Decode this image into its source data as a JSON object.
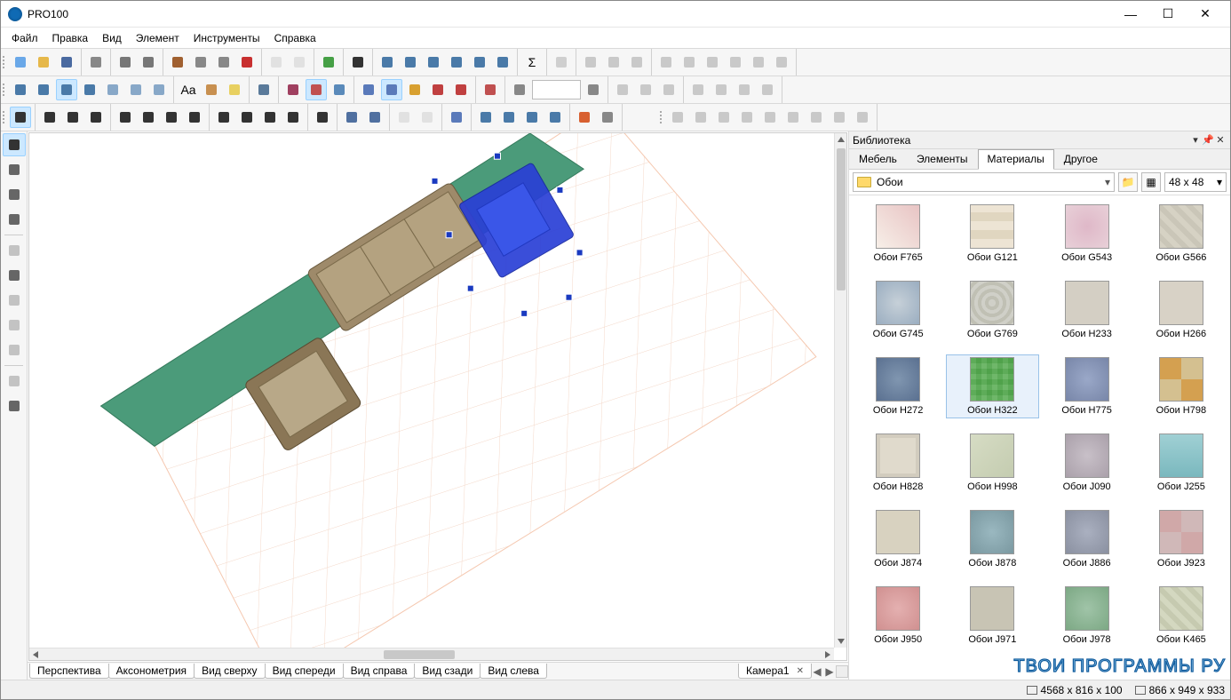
{
  "titlebar": {
    "title": "PRO100"
  },
  "menu": [
    "Файл",
    "Правка",
    "Вид",
    "Элемент",
    "Инструменты",
    "Справка"
  ],
  "viewtabs": [
    "Перспектива",
    "Аксонометрия",
    "Вид сверху",
    "Вид спереди",
    "Вид справа",
    "Вид сзади",
    "Вид слева"
  ],
  "camera_tab": "Камера1",
  "library": {
    "title": "Библиотека",
    "tabs": [
      "Мебель",
      "Элементы",
      "Материалы",
      "Другое"
    ],
    "active_tab": 2,
    "path": "Обои",
    "thumb_size": "48 x  48",
    "selected": "Обои H322",
    "items": [
      {
        "id": "F765",
        "label": "Обои F765"
      },
      {
        "id": "G121",
        "label": "Обои G121"
      },
      {
        "id": "G543",
        "label": "Обои G543"
      },
      {
        "id": "G566",
        "label": "Обои G566"
      },
      {
        "id": "G745",
        "label": "Обои G745"
      },
      {
        "id": "G769",
        "label": "Обои G769"
      },
      {
        "id": "H233",
        "label": "Обои H233"
      },
      {
        "id": "H266",
        "label": "Обои H266"
      },
      {
        "id": "H272",
        "label": "Обои H272"
      },
      {
        "id": "H322",
        "label": "Обои H322"
      },
      {
        "id": "H775",
        "label": "Обои H775"
      },
      {
        "id": "H798",
        "label": "Обои H798"
      },
      {
        "id": "H828",
        "label": "Обои H828"
      },
      {
        "id": "H998",
        "label": "Обои H998"
      },
      {
        "id": "J090",
        "label": "Обои J090"
      },
      {
        "id": "J255",
        "label": "Обои J255"
      },
      {
        "id": "J874",
        "label": "Обои J874"
      },
      {
        "id": "J878",
        "label": "Обои J878"
      },
      {
        "id": "J886",
        "label": "Обои J886"
      },
      {
        "id": "J923",
        "label": "Обои J923"
      },
      {
        "id": "J950",
        "label": "Обои J950"
      },
      {
        "id": "J971",
        "label": "Обои J971"
      },
      {
        "id": "J978",
        "label": "Обои J978"
      },
      {
        "id": "K465",
        "label": "Обои K465"
      }
    ]
  },
  "status": {
    "dims1": "4568 x 816 x 100",
    "dims2": "866 x 949 x 933"
  },
  "watermark": "ТВОИ ПРОГРАММЫ РУ",
  "toolbars": {
    "row1": [
      {
        "g": [
          {
            "n": "new-icon",
            "c": "#6aa8e8"
          },
          {
            "n": "open-icon",
            "c": "#e6b84a"
          },
          {
            "n": "save-icon",
            "c": "#4a6aa0"
          }
        ]
      },
      {
        "g": [
          {
            "n": "export-icon",
            "c": "#888"
          }
        ]
      },
      {
        "g": [
          {
            "n": "print-icon",
            "c": "#777"
          },
          {
            "n": "print-preview-icon",
            "c": "#777"
          }
        ]
      },
      {
        "g": [
          {
            "n": "cut-icon",
            "c": "#a06030"
          },
          {
            "n": "copy-icon",
            "c": "#888"
          },
          {
            "n": "paste-icon",
            "c": "#888"
          },
          {
            "n": "delete-icon",
            "c": "#c83030"
          }
        ]
      },
      {
        "g": [
          {
            "n": "undo-icon",
            "c": "#bbb",
            "d": true
          },
          {
            "n": "redo-icon",
            "c": "#bbb",
            "d": true
          }
        ]
      },
      {
        "g": [
          {
            "n": "properties-icon",
            "c": "#46a046"
          }
        ]
      },
      {
        "g": [
          {
            "n": "check-icon",
            "c": "#333"
          }
        ]
      },
      {
        "g": [
          {
            "n": "align-panel-icon",
            "c": "#4a7aa8"
          },
          {
            "n": "distribute-icon",
            "c": "#4a7aa8"
          },
          {
            "n": "arrange-icon",
            "c": "#4a7aa8"
          },
          {
            "n": "flatten-icon",
            "c": "#4a7aa8"
          },
          {
            "n": "group-panel-icon",
            "c": "#4a7aa8"
          },
          {
            "n": "layers-icon",
            "c": "#4a7aa8"
          }
        ]
      },
      {
        "g": [
          {
            "n": "sum-icon",
            "t": "Σ"
          }
        ]
      },
      {
        "g": [
          {
            "n": "mail-icon",
            "c": "#888",
            "d": true
          }
        ]
      },
      {
        "g": [
          {
            "n": "flip-h-icon",
            "d": true
          },
          {
            "n": "flip-v-icon",
            "d": true
          },
          {
            "n": "mirror-icon",
            "d": true
          }
        ]
      },
      {
        "g": [
          {
            "n": "align-left-icon",
            "d": true
          },
          {
            "n": "align-center-h-icon",
            "d": true
          },
          {
            "n": "align-right-icon",
            "d": true
          },
          {
            "n": "align-top-icon",
            "d": true
          },
          {
            "n": "align-center-v-icon",
            "d": true
          },
          {
            "n": "align-bottom-icon",
            "d": true
          }
        ]
      }
    ],
    "row2": [
      {
        "g": [
          {
            "n": "view-persp-icon",
            "c": "#4a7aa8"
          },
          {
            "n": "view-axo-icon",
            "c": "#4a7aa8"
          },
          {
            "n": "view-top-icon",
            "c": "#4a7aa8",
            "a": true
          },
          {
            "n": "view-front-icon",
            "c": "#4a7aa8"
          },
          {
            "n": "view-right-icon",
            "c": "#88a8c8"
          },
          {
            "n": "view-back-icon",
            "c": "#88a8c8"
          },
          {
            "n": "view-left-icon",
            "c": "#88a8c8"
          }
        ]
      },
      {
        "g": [
          {
            "n": "text-annot-icon",
            "t": "Aa"
          },
          {
            "n": "material-ball-icon",
            "c": "#c89050"
          },
          {
            "n": "light-icon",
            "c": "#e8d060"
          }
        ]
      },
      {
        "g": [
          {
            "n": "link-icon",
            "c": "#5a7a9a"
          }
        ]
      },
      {
        "g": [
          {
            "n": "dimension-icon",
            "c": "#a04060"
          },
          {
            "n": "grid-icon",
            "c": "#c05050",
            "a": true
          },
          {
            "n": "visibility-icon",
            "c": "#5a8aba"
          }
        ]
      },
      {
        "g": [
          {
            "n": "snap-end-icon",
            "c": "#5a7aba"
          },
          {
            "n": "snap-mid-icon",
            "c": "#5a7aba",
            "a": true
          },
          {
            "n": "snap-center-icon",
            "c": "#d8a030"
          },
          {
            "n": "magnet-icon",
            "c": "#c04040"
          },
          {
            "n": "target-icon",
            "c": "#c04040"
          }
        ]
      },
      {
        "g": [
          {
            "n": "camera-icon",
            "c": "#c05050"
          }
        ]
      },
      {
        "g": [
          {
            "n": "zoom-out-icon",
            "c": "#888"
          },
          {
            "n": "zoom-combo",
            "combo": true
          },
          {
            "n": "zoom-in-icon",
            "c": "#888"
          }
        ]
      },
      {
        "g": [
          {
            "n": "guide-h-icon",
            "d": true
          },
          {
            "n": "guide-v-icon",
            "d": true
          },
          {
            "n": "guide-both-icon",
            "d": true
          }
        ]
      },
      {
        "g": [
          {
            "n": "dim-linear-icon",
            "d": true
          },
          {
            "n": "dim-aligned-icon",
            "d": true
          },
          {
            "n": "dim-vert-icon",
            "d": true
          },
          {
            "n": "dim-gap-icon",
            "d": true
          }
        ]
      }
    ],
    "row3": [
      {
        "g": [
          {
            "n": "snap-grid-icon",
            "c": "#333",
            "a": true
          }
        ]
      },
      {
        "g": [
          {
            "n": "select-icon",
            "c": "#333"
          },
          {
            "n": "node-edit-icon",
            "c": "#333"
          },
          {
            "n": "polyline-icon",
            "c": "#333"
          }
        ]
      },
      {
        "g": [
          {
            "n": "group-icon",
            "c": "#333"
          },
          {
            "n": "ungroup-icon",
            "c": "#333"
          },
          {
            "n": "anchor-icon",
            "c": "#333"
          },
          {
            "n": "unanchor-icon",
            "c": "#333"
          }
        ]
      },
      {
        "g": [
          {
            "n": "rotate-icon",
            "c": "#333"
          },
          {
            "n": "move-icon",
            "c": "#333"
          },
          {
            "n": "mirror2-icon",
            "c": "#333"
          },
          {
            "n": "scale-icon",
            "c": "#333"
          }
        ]
      },
      {
        "g": [
          {
            "n": "ruler-icon",
            "c": "#333"
          }
        ]
      },
      {
        "g": [
          {
            "n": "hide-icon",
            "c": "#5070a0"
          },
          {
            "n": "unhide-icon",
            "c": "#5070a0"
          }
        ]
      },
      {
        "g": [
          {
            "n": "lock-icon",
            "c": "#bbb",
            "d": true
          },
          {
            "n": "unlock-icon",
            "c": "#bbb",
            "d": true
          }
        ]
      },
      {
        "g": [
          {
            "n": "crosshair-icon",
            "c": "#5a7aba"
          }
        ]
      },
      {
        "g": [
          {
            "n": "snap-perp-icon",
            "c": "#4a7aa8"
          },
          {
            "n": "snap-tan-icon",
            "c": "#4a7aa8"
          },
          {
            "n": "snap-near-icon",
            "c": "#4a7aa8"
          },
          {
            "n": "snap-int-icon",
            "c": "#4a7aa8"
          }
        ]
      },
      {
        "g": [
          {
            "n": "explode-icon",
            "c": "#d86030"
          },
          {
            "n": "combine-icon",
            "c": "#888"
          }
        ]
      },
      {
        "spacer": true
      },
      {
        "g": [
          {
            "n": "panel-a-icon",
            "d": true
          },
          {
            "n": "panel-b-icon",
            "d": true
          },
          {
            "n": "panel-c-icon",
            "d": true
          },
          {
            "n": "panel-d-icon",
            "d": true
          },
          {
            "n": "panel-e-icon",
            "d": true
          },
          {
            "n": "panel-f-icon",
            "d": true
          },
          {
            "n": "panel-g-icon",
            "d": true
          },
          {
            "n": "panel-h-icon",
            "d": true
          },
          {
            "n": "panel-i-icon",
            "d": true
          }
        ]
      }
    ],
    "vertical": [
      {
        "n": "pointer-tool-icon",
        "a": true
      },
      {
        "n": "dimension-tool-icon"
      },
      {
        "n": "section-tool-icon"
      },
      {
        "n": "eyedropper-tool-icon"
      },
      {
        "sep": true
      },
      {
        "n": "wall-tool-icon",
        "d": true
      },
      {
        "n": "pier-tool-icon"
      },
      {
        "n": "door-tool-icon",
        "d": true
      },
      {
        "n": "window-tool-icon",
        "d": true
      },
      {
        "n": "stairs-tool-icon",
        "d": true
      },
      {
        "sep": true
      },
      {
        "n": "orbit-tool-icon",
        "d": true
      },
      {
        "n": "zoom-tool-icon"
      }
    ]
  }
}
